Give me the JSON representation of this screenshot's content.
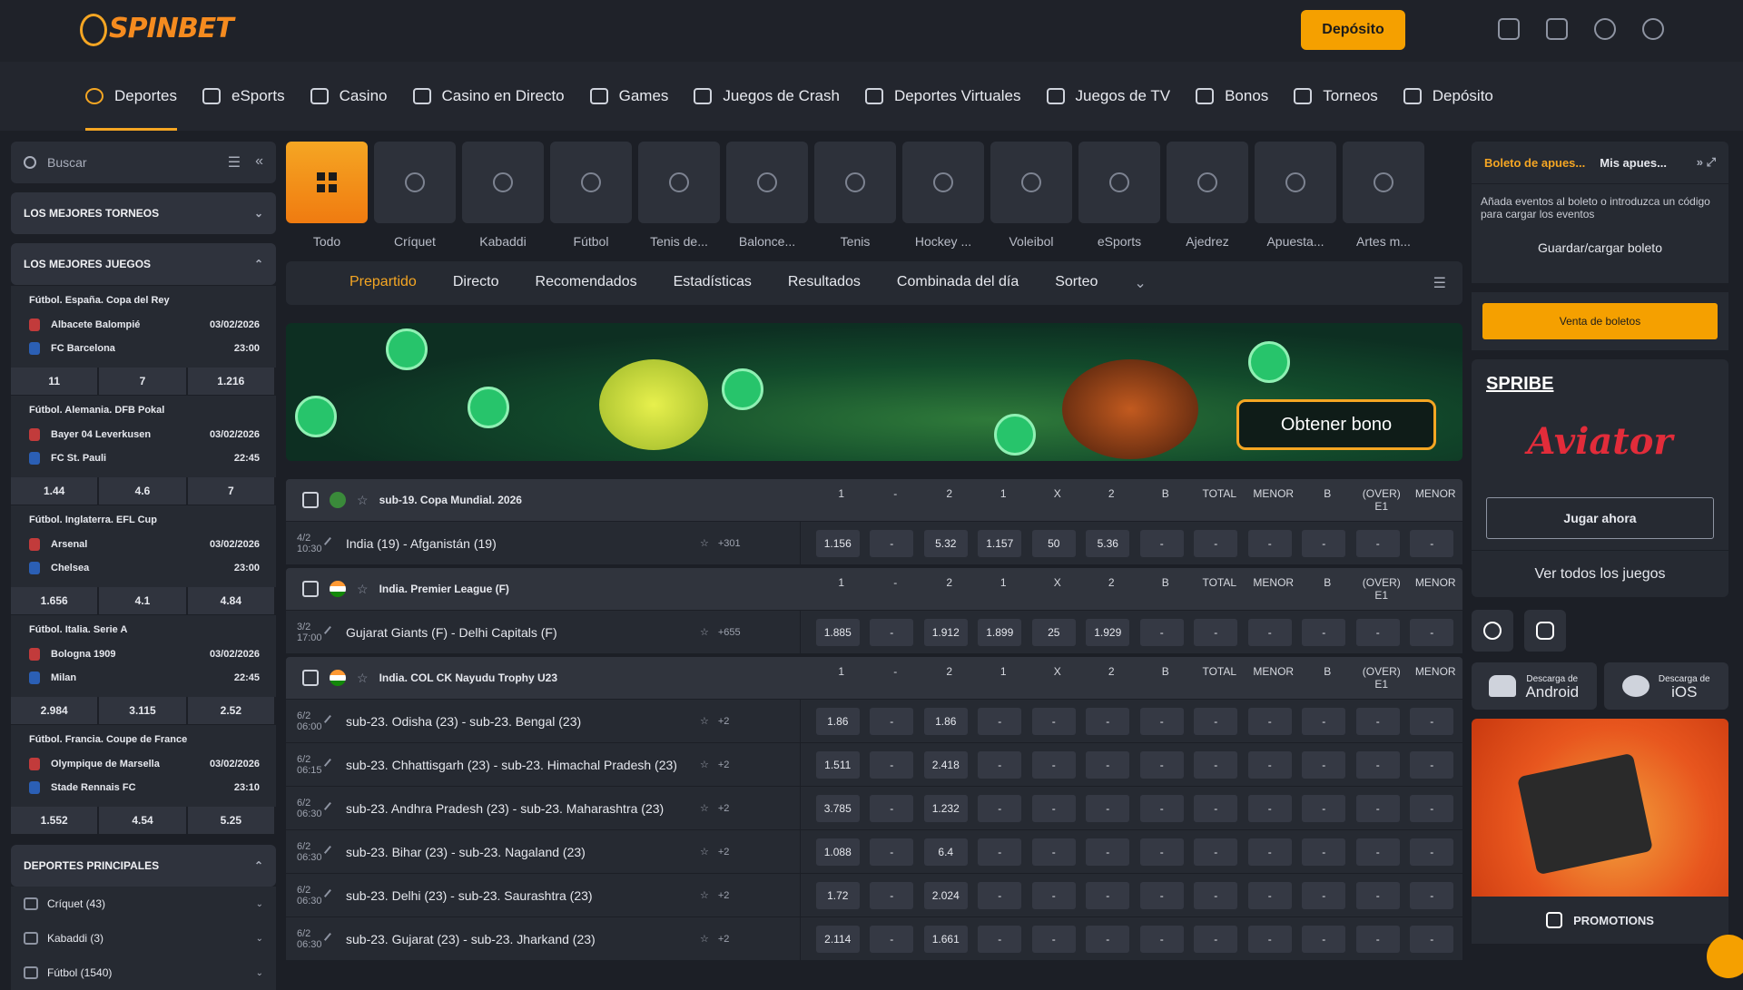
{
  "header": {
    "logo": "SPINBET",
    "deposit_button": "Depósito"
  },
  "nav": [
    {
      "label": "Deportes",
      "icon": "soccer-icon"
    },
    {
      "label": "eSports",
      "icon": "gamepad-icon"
    },
    {
      "label": "Casino",
      "icon": "slot-icon"
    },
    {
      "label": "Casino en Directo",
      "icon": "dealer-icon"
    },
    {
      "label": "Games",
      "icon": "dice-icon"
    },
    {
      "label": "Juegos de Crash",
      "icon": "rocket-icon"
    },
    {
      "label": "Deportes Virtuales",
      "icon": "vr-icon"
    },
    {
      "label": "Juegos de TV",
      "icon": "tv-icon"
    },
    {
      "label": "Bonos",
      "icon": "gift-icon"
    },
    {
      "label": "Torneos",
      "icon": "trophy-icon"
    },
    {
      "label": "Depósito",
      "icon": "wallet-icon"
    }
  ],
  "sidebar": {
    "search_placeholder": "Buscar",
    "top_tournaments": "LOS MEJORES TORNEOS",
    "top_games": "LOS MEJORES JUEGOS",
    "main_sports": "DEPORTES PRINCIPALES",
    "games": [
      {
        "league": "Fútbol. España. Copa del Rey",
        "home": "Albacete Balompié",
        "away": "FC Barcelona",
        "date": "03/02/2026",
        "time": "23:00",
        "odds": [
          "11",
          "7",
          "1.216"
        ]
      },
      {
        "league": "Fútbol. Alemania. DFB Pokal",
        "home": "Bayer 04 Leverkusen",
        "away": "FC St. Pauli",
        "date": "03/02/2026",
        "time": "22:45",
        "odds": [
          "1.44",
          "4.6",
          "7"
        ]
      },
      {
        "league": "Fútbol. Inglaterra. EFL Cup",
        "home": "Arsenal",
        "away": "Chelsea",
        "date": "03/02/2026",
        "time": "23:00",
        "odds": [
          "1.656",
          "4.1",
          "4.84"
        ]
      },
      {
        "league": "Fútbol. Italia. Serie A",
        "home": "Bologna 1909",
        "away": "Milan",
        "date": "03/02/2026",
        "time": "22:45",
        "odds": [
          "2.984",
          "3.115",
          "2.52"
        ]
      },
      {
        "league": "Fútbol. Francia. Coupe de France",
        "home": "Olympique de Marsella",
        "away": "Stade Rennais FC",
        "date": "03/02/2026",
        "time": "23:10",
        "odds": [
          "1.552",
          "4.54",
          "5.25"
        ]
      }
    ],
    "sports": [
      {
        "label": "Críquet (43)"
      },
      {
        "label": "Kabaddi (3)"
      },
      {
        "label": "Fútbol (1540)"
      }
    ]
  },
  "categories": [
    {
      "label": "Todo"
    },
    {
      "label": "Críquet"
    },
    {
      "label": "Kabaddi"
    },
    {
      "label": "Fútbol"
    },
    {
      "label": "Tenis de..."
    },
    {
      "label": "Balonce..."
    },
    {
      "label": "Tenis"
    },
    {
      "label": "Hockey ..."
    },
    {
      "label": "Voleibol"
    },
    {
      "label": "eSports"
    },
    {
      "label": "Ajedrez"
    },
    {
      "label": "Apuesta..."
    },
    {
      "label": "Artes m..."
    }
  ],
  "tabs": [
    "Prepartido",
    "Directo",
    "Recomendados",
    "Estadísticas",
    "Resultados",
    "Combinada del día",
    "Sorteo"
  ],
  "banner": {
    "cta": "Obtener bono"
  },
  "columns": [
    "1",
    "-",
    "2",
    "1",
    "X",
    "2",
    "B",
    "TOTAL",
    "MENOR",
    "B",
    "(OVER) E1",
    "MENOR"
  ],
  "leagues": [
    {
      "name": "sub-19. Copa Mundial. 2026",
      "matches": [
        {
          "date": "4/2",
          "time": "10:30",
          "name": "India (19) - Afganistán (19)",
          "more": "+301",
          "odds": [
            "1.156",
            "-",
            "5.32",
            "1.157",
            "50",
            "5.36",
            "-",
            "-",
            "-",
            "-",
            "-",
            "-"
          ]
        }
      ]
    },
    {
      "name": "India. Premier League (F)",
      "matches": [
        {
          "date": "3/2",
          "time": "17:00",
          "name": "Gujarat Giants (F) - Delhi Capitals (F)",
          "more": "+655",
          "odds": [
            "1.885",
            "-",
            "1.912",
            "1.899",
            "25",
            "1.929",
            "-",
            "-",
            "-",
            "-",
            "-",
            "-"
          ]
        }
      ]
    },
    {
      "name": "India. COL CK Nayudu Trophy U23",
      "matches": [
        {
          "date": "6/2",
          "time": "06:00",
          "name": "sub-23. Odisha (23) - sub-23. Bengal (23)",
          "more": "+2",
          "odds": [
            "1.86",
            "-",
            "1.86",
            "-",
            "-",
            "-",
            "-",
            "-",
            "-",
            "-",
            "-",
            "-"
          ]
        },
        {
          "date": "6/2",
          "time": "06:15",
          "name": "sub-23. Chhattisgarh (23) - sub-23. Himachal Pradesh (23)",
          "more": "+2",
          "odds": [
            "1.511",
            "-",
            "2.418",
            "-",
            "-",
            "-",
            "-",
            "-",
            "-",
            "-",
            "-",
            "-"
          ]
        },
        {
          "date": "6/2",
          "time": "06:30",
          "name": "sub-23. Andhra Pradesh (23) - sub-23. Maharashtra (23)",
          "more": "+2",
          "odds": [
            "3.785",
            "-",
            "1.232",
            "-",
            "-",
            "-",
            "-",
            "-",
            "-",
            "-",
            "-",
            "-"
          ]
        },
        {
          "date": "6/2",
          "time": "06:30",
          "name": "sub-23. Bihar (23) - sub-23. Nagaland (23)",
          "more": "+2",
          "odds": [
            "1.088",
            "-",
            "6.4",
            "-",
            "-",
            "-",
            "-",
            "-",
            "-",
            "-",
            "-",
            "-"
          ]
        },
        {
          "date": "6/2",
          "time": "06:30",
          "name": "sub-23. Delhi (23) - sub-23. Saurashtra (23)",
          "more": "+2",
          "odds": [
            "1.72",
            "-",
            "2.024",
            "-",
            "-",
            "-",
            "-",
            "-",
            "-",
            "-",
            "-",
            "-"
          ]
        },
        {
          "date": "6/2",
          "time": "06:30",
          "name": "sub-23. Gujarat (23) - sub-23. Jharkand (23)",
          "more": "+2",
          "odds": [
            "2.114",
            "-",
            "1.661",
            "-",
            "-",
            "-",
            "-",
            "-",
            "-",
            "-",
            "-",
            "-"
          ]
        }
      ]
    }
  ],
  "right_panel": {
    "tab_slip": "Boleto de apues...",
    "tab_bets": "Mis apues...",
    "slip_hint": "Añada eventos al boleto o introduzca un código para cargar los eventos",
    "save_load": "Guardar/cargar boleto",
    "sell": "Venta de boletos",
    "provider": "SPRIBE",
    "game": "Aviator",
    "play": "Jugar ahora",
    "all_games": "Ver todos los juegos",
    "download_label": "Descarga de",
    "android": "Android",
    "ios": "iOS",
    "promotions": "PROMOTIONS"
  },
  "colors": {
    "accent": "#f5a623",
    "bg": "#1c1f26",
    "panel": "#262a32"
  }
}
